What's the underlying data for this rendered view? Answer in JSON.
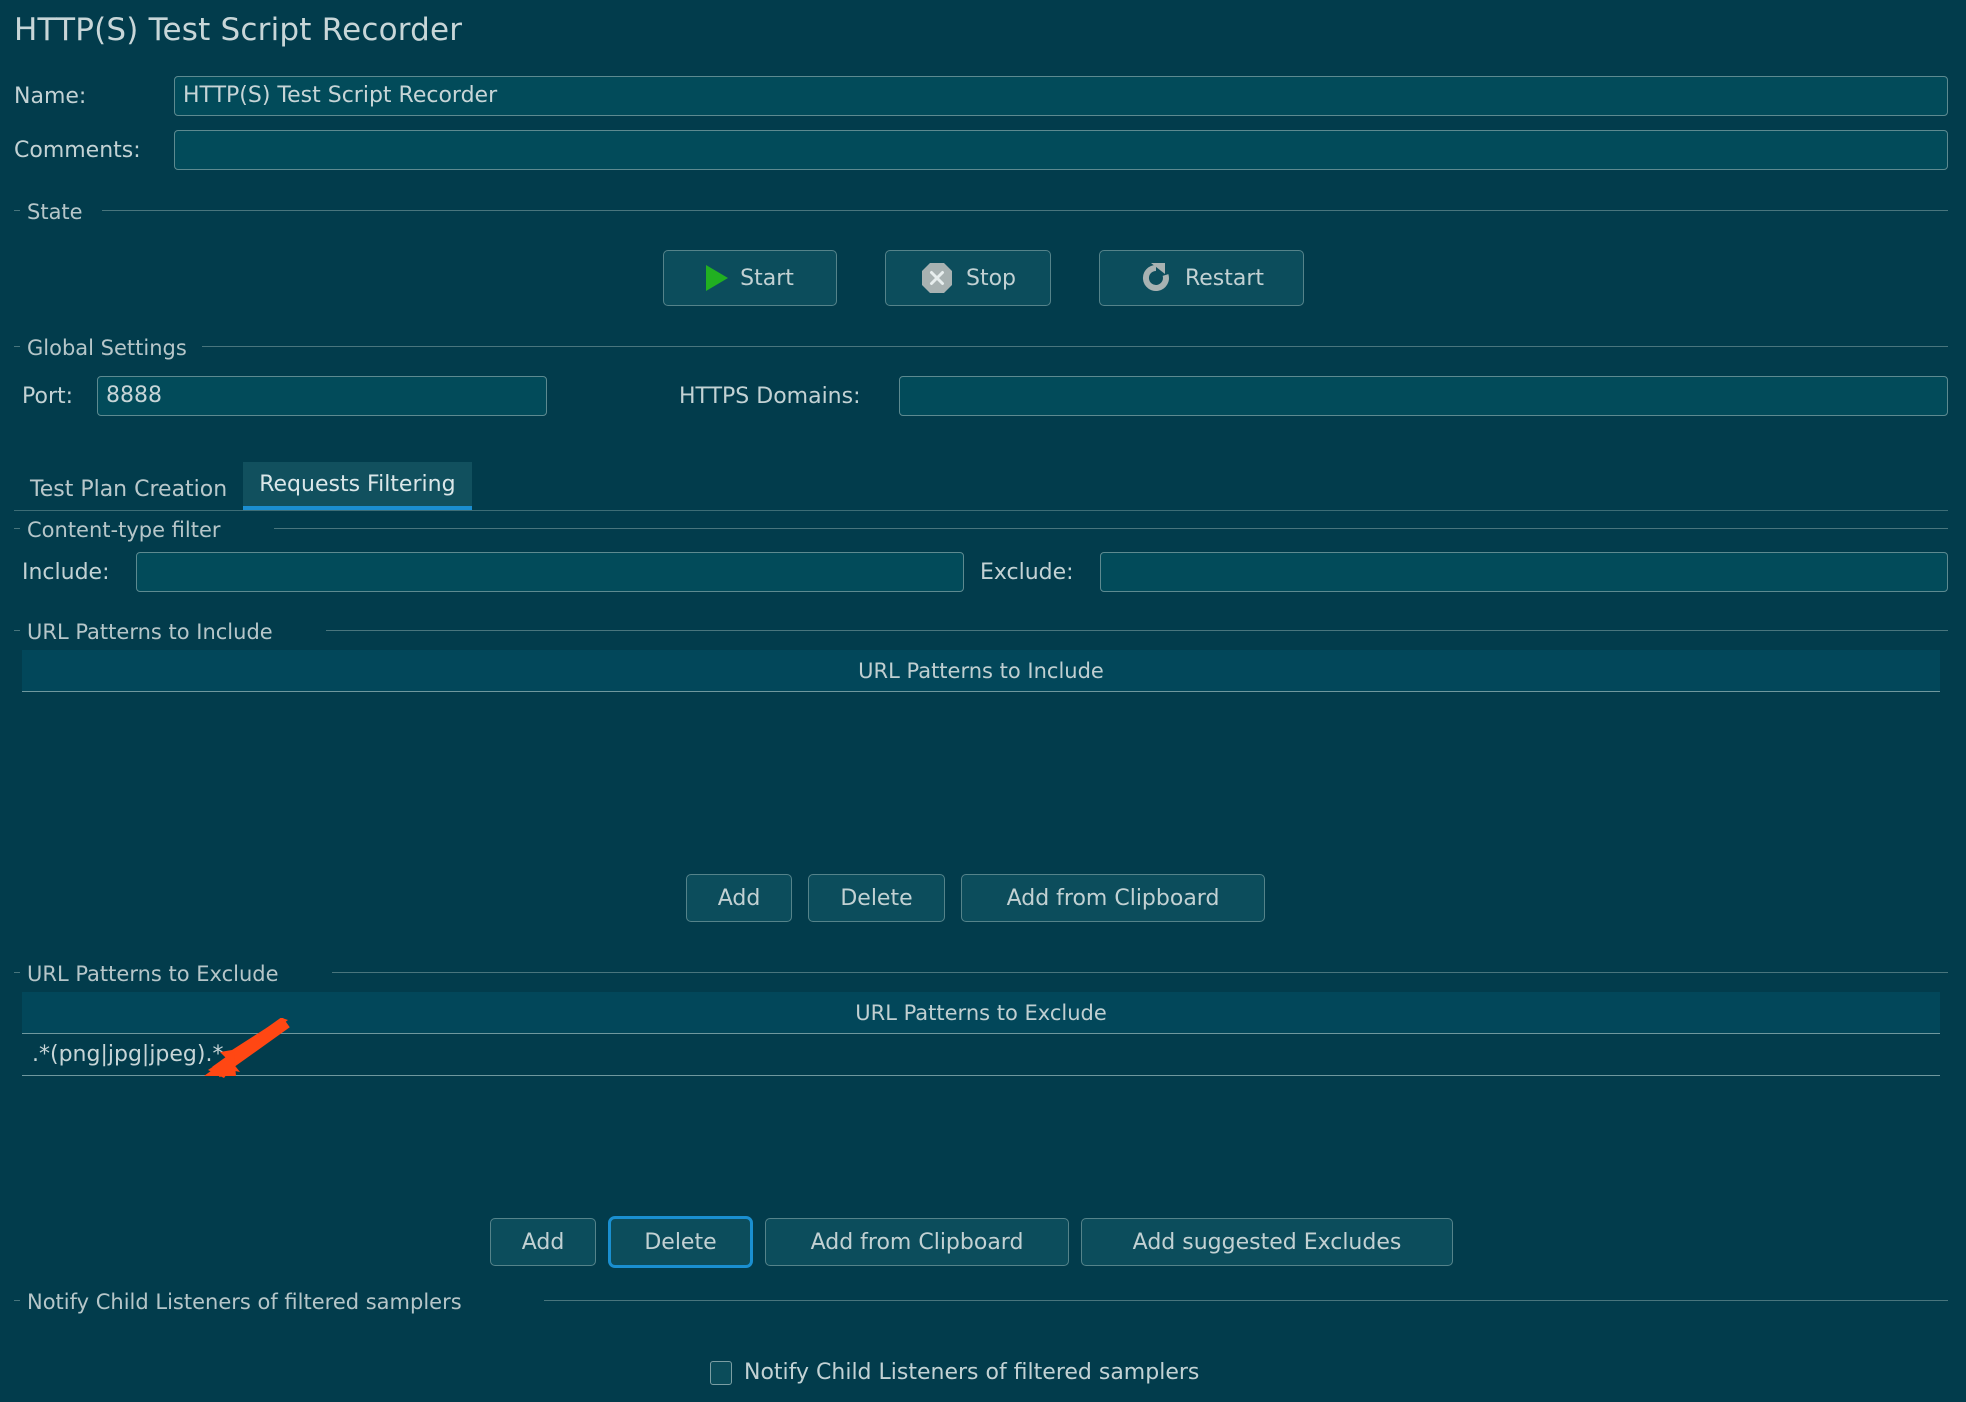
{
  "window": {
    "title": "HTTP(S) Test Script Recorder"
  },
  "name_field": {
    "label": "Name:",
    "value": "HTTP(S) Test Script Recorder"
  },
  "comments_field": {
    "label": "Comments:",
    "value": ""
  },
  "state_group": {
    "title": "State",
    "buttons": [
      {
        "label": "Start",
        "icon": "play-icon"
      },
      {
        "label": "Stop",
        "icon": "stop-octagon-icon"
      },
      {
        "label": "Restart",
        "icon": "restart-arrow-icon"
      }
    ]
  },
  "global_settings": {
    "title": "Global Settings",
    "port_label": "Port:",
    "port_value": "8888",
    "https_domains_label": "HTTPS Domains:",
    "https_domains_value": ""
  },
  "tabs": [
    {
      "label": "Test Plan Creation",
      "active": false
    },
    {
      "label": "Requests Filtering",
      "active": true
    }
  ],
  "content_type_filter": {
    "title": "Content-type filter",
    "include_label": "Include:",
    "include_value": "",
    "exclude_label": "Exclude:",
    "exclude_value": ""
  },
  "url_include": {
    "title": "URL Patterns to Include",
    "column_header": "URL Patterns to Include",
    "rows": [],
    "buttons": [
      {
        "label": "Add",
        "focused": false
      },
      {
        "label": "Delete",
        "focused": false
      },
      {
        "label": "Add from Clipboard",
        "focused": false
      }
    ]
  },
  "url_exclude": {
    "title": "URL Patterns to Exclude",
    "column_header": "URL Patterns to Exclude",
    "rows": [
      ".*(png|jpg|jpeg).*"
    ],
    "buttons": [
      {
        "label": "Add",
        "focused": false
      },
      {
        "label": "Delete",
        "focused": true
      },
      {
        "label": "Add from Clipboard",
        "focused": false
      },
      {
        "label": "Add suggested Excludes",
        "focused": false
      }
    ]
  },
  "notify_group": {
    "title": "Notify Child Listeners of filtered samplers",
    "checkbox_label": "Notify Child Listeners of filtered samplers",
    "checked": false
  },
  "annotation": {
    "type": "arrow",
    "color": "#FF4713",
    "points_at": ".*(png|jpg|jpeg).*"
  },
  "colors": {
    "background": "#023c4c",
    "field_background": "#024b5a",
    "accent_blue": "#1b8ed0",
    "start_green": "#21b021",
    "border": "#5d8a90",
    "text": "#c3d2d4"
  }
}
